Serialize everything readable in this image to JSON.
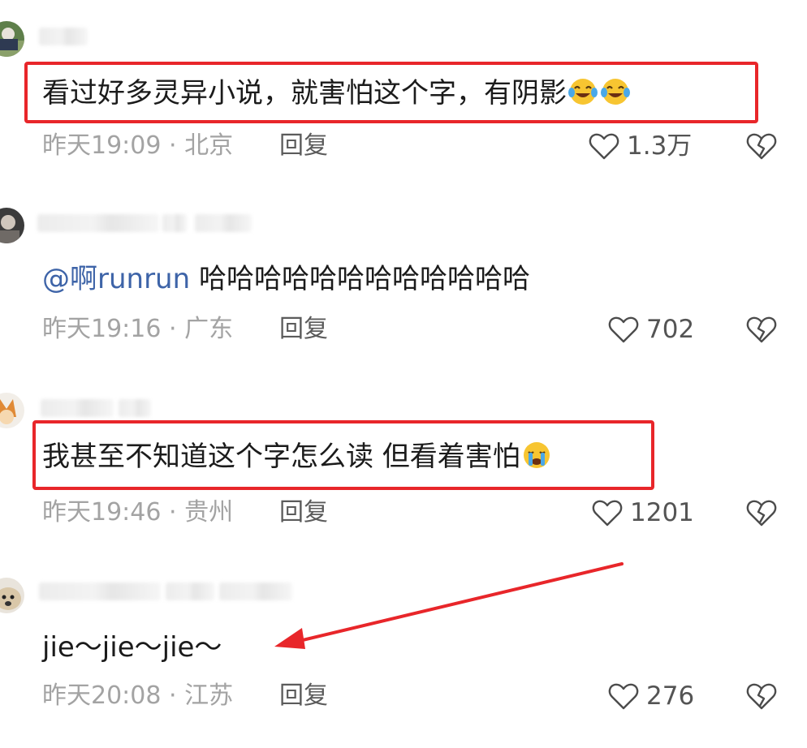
{
  "comments": [
    {
      "content": "看过好多灵异小说，就害怕这个字，有阴影",
      "emoji_icons": [
        "laughing-crying-emoji",
        "laughing-crying-emoji"
      ],
      "meta": "昨天19:09 · 北京",
      "reply_label": "回复",
      "likes": "1.3万",
      "highlighted": true
    },
    {
      "mention": "@啊runrun",
      "content": " 哈哈哈哈哈哈哈哈哈哈哈哈",
      "meta": "昨天19:16 · 广东",
      "reply_label": "回复",
      "likes": "702",
      "highlighted": false
    },
    {
      "content": "我甚至不知道这个字怎么读 但看着害怕",
      "emoji_icons": [
        "loudly-crying-emoji"
      ],
      "meta": "昨天19:46 · 贵州",
      "reply_label": "回复",
      "likes": "1201",
      "highlighted": true
    },
    {
      "content": "jie～jie～jie～",
      "meta": "昨天20:08 · 江苏",
      "reply_label": "回复",
      "likes": "276",
      "highlighted": false
    }
  ],
  "icons": {
    "like": "heart-outline-icon",
    "dislike": "broken-heart-icon"
  },
  "colors": {
    "highlight_border": "#e8262a",
    "arrow": "#e8262a",
    "mention": "#3e64a8",
    "meta_text": "#a3a3a3",
    "content_text": "#1b1b1b"
  }
}
